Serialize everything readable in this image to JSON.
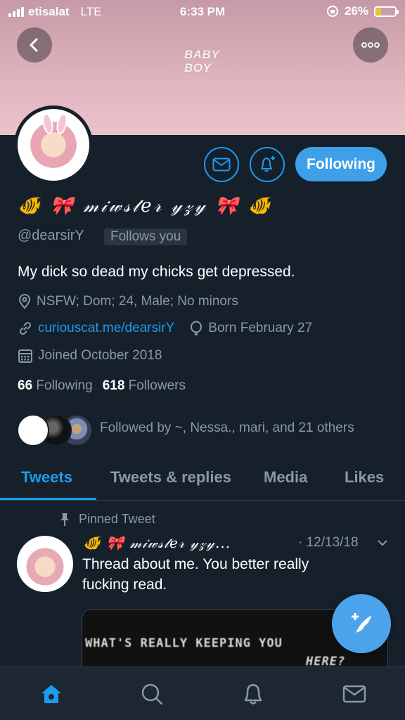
{
  "status_bar": {
    "carrier": "etisalat",
    "network": "LTE",
    "time": "6:33 PM",
    "battery": "26%",
    "battery_level": 0.26
  },
  "header": {
    "banner_text": "BABY BOY"
  },
  "profile": {
    "display_name": "🐠 🎀 𝓂𝒾𝓌𝓈𝓉𝑒𝓇 𝓎𝓏𝓎 🎀 🐠",
    "handle": "@dearsirY",
    "follows_you": "Follows you",
    "bio": "My dick so dead my chicks get depressed.",
    "location": "NSFW; Dom; 24, Male; No minors",
    "website": "curiouscat.me/dearsirY",
    "birthday": "Born February 27",
    "joined": "Joined October 2018",
    "following_count": "66",
    "following_label": "Following",
    "followers_count": "618",
    "followers_label": "Followers",
    "followed_by": "Followed by ~, Nessa., mari, and 21 others"
  },
  "actions": {
    "follow_button": "Following"
  },
  "tabs": [
    "Tweets",
    "Tweets & replies",
    "Media",
    "Likes"
  ],
  "pinned_tweet": {
    "label": "Pinned Tweet",
    "author": "🐠 🎀 𝓂𝒾𝓌𝓈𝓉𝑒𝓇 𝓎𝓏𝓎...",
    "date": "· 12/13/18",
    "text": "Thread about me. You better really fucking read.",
    "media_line1": "WHAT'S REALLY KEEPING YOU",
    "media_line2": "HERE?"
  },
  "colors": {
    "background": "#15202b",
    "accent": "#1d9bf0",
    "secondary_text": "#8b98a5",
    "banner": "#e2b7c1"
  },
  "icons": {
    "back": "chevron-left-icon",
    "more": "more-horizontal-icon",
    "message": "envelope-icon",
    "notify": "bell-plus-icon",
    "location": "location-pin-icon",
    "link": "link-icon",
    "birthday": "balloon-icon",
    "calendar": "calendar-icon",
    "pin": "pin-icon",
    "compose": "feather-plus-icon",
    "home": "home-icon",
    "search": "search-icon",
    "notifications": "bell-icon",
    "messages": "envelope-icon"
  }
}
